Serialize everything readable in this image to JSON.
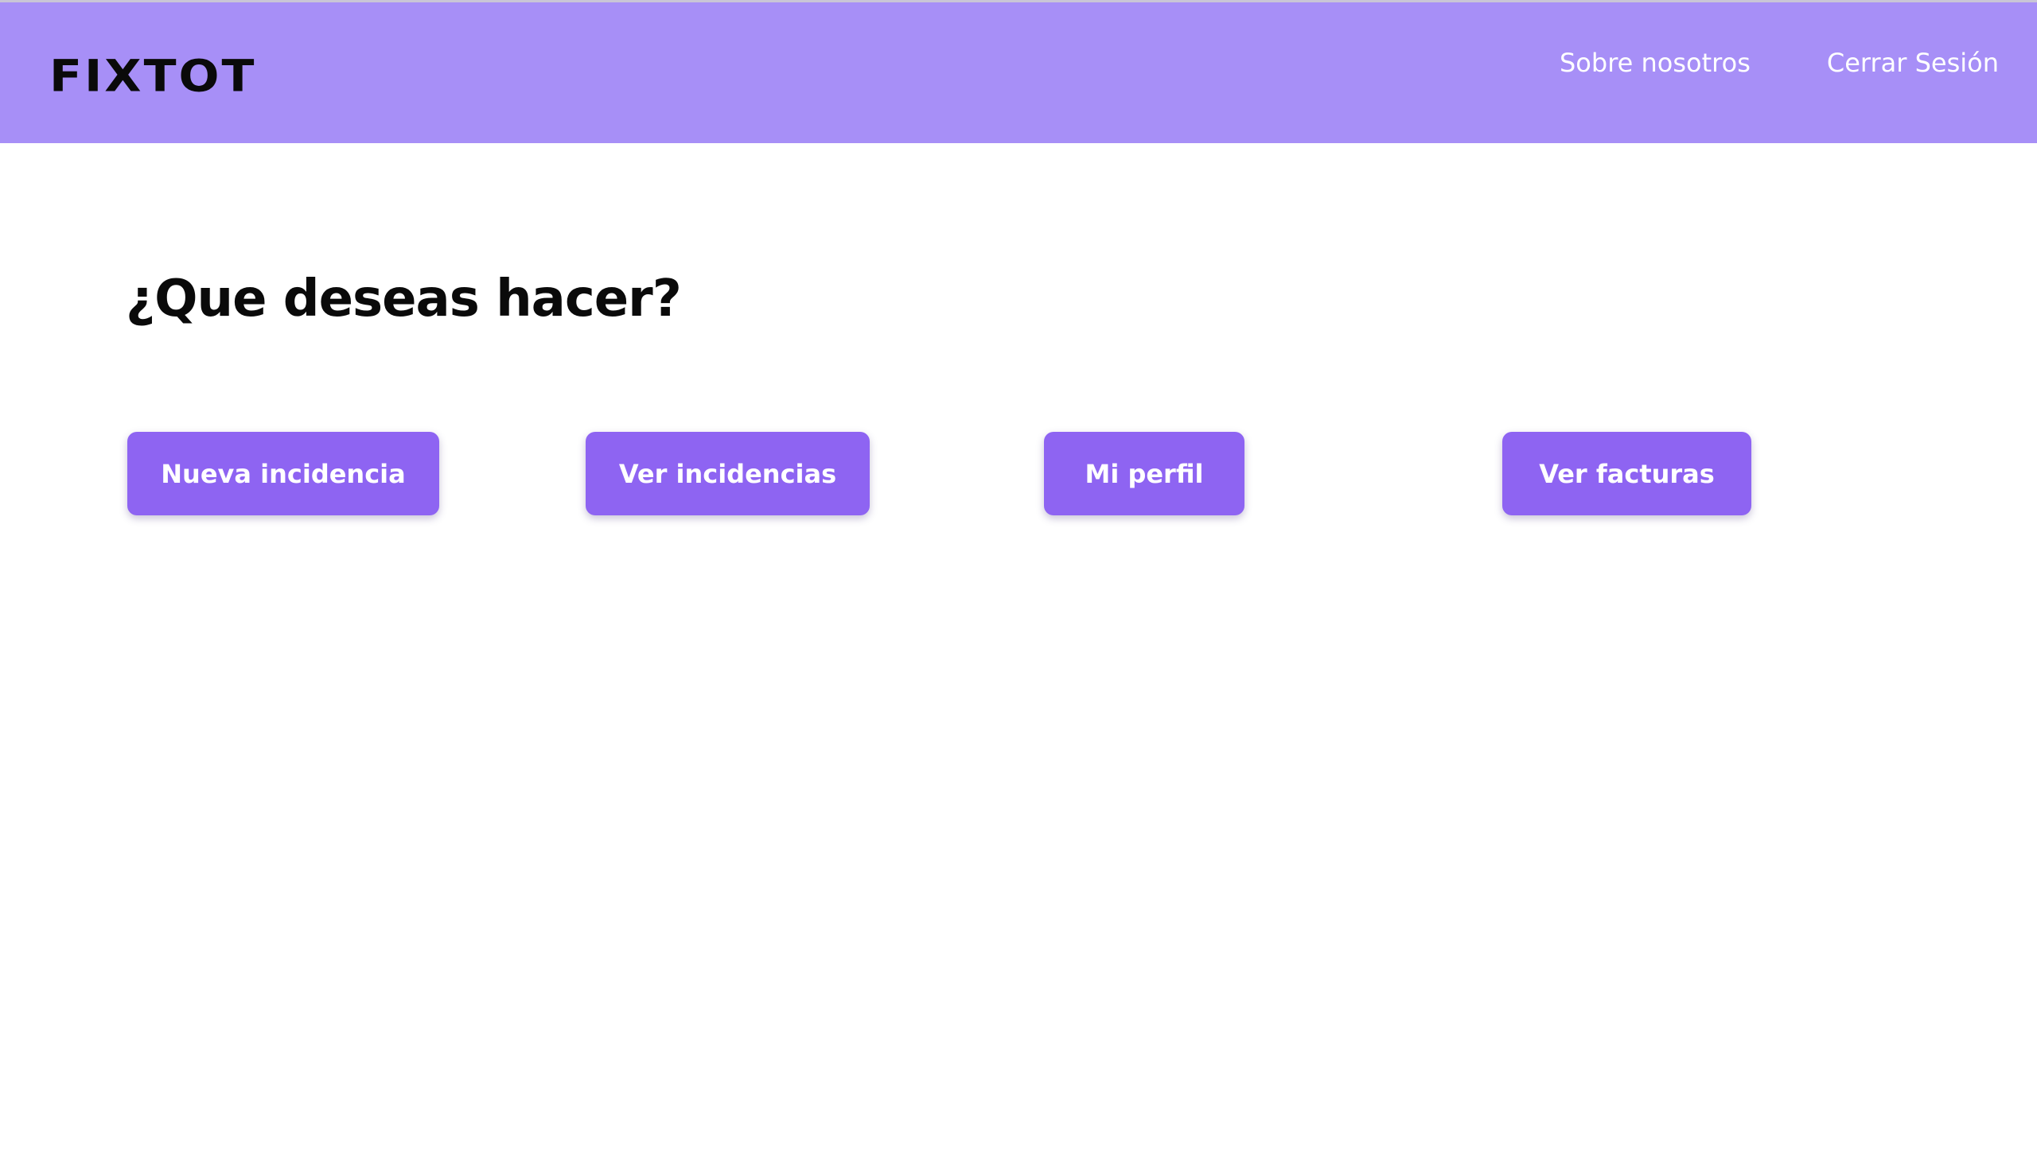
{
  "header": {
    "logo_text": "FIXTOT",
    "nav": [
      {
        "label": "Sobre nosotros"
      },
      {
        "label": "Cerrar Sesión"
      }
    ]
  },
  "main": {
    "title": "¿Que deseas hacer?",
    "actions": [
      {
        "label": "Nueva incidencia"
      },
      {
        "label": "Ver incidencias"
      },
      {
        "label": "Mi perfil"
      },
      {
        "label": "Ver facturas"
      }
    ]
  },
  "colors": {
    "header_bg": "#a78ff7",
    "button_bg": "#8e64f2",
    "nav_text": "#ffffff",
    "title_text": "#0a0a0a"
  }
}
